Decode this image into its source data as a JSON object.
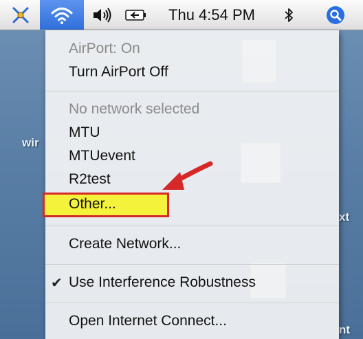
{
  "menubar": {
    "clock": "Thu 4:54 PM",
    "icons": [
      "script-menu-icon",
      "airport-icon",
      "volume-icon",
      "battery-icon",
      "bluetooth-icon",
      "spotlight-icon"
    ]
  },
  "desktop": {
    "label_left": "wir",
    "ghost_right_1": "xt",
    "ghost_right_2": "nt"
  },
  "menu": {
    "status": "AirPort: On",
    "toggle": "Turn AirPort Off",
    "network_header": "No network selected",
    "networks": [
      "MTU",
      "MTUevent",
      "R2test"
    ],
    "other": "Other...",
    "create": "Create Network...",
    "interference": "Use Interference Robustness",
    "interference_checked": true,
    "open_connect": "Open Internet Connect..."
  },
  "annotation": {
    "highlight_color": "#f4f23a",
    "border_color": "#d62828"
  }
}
